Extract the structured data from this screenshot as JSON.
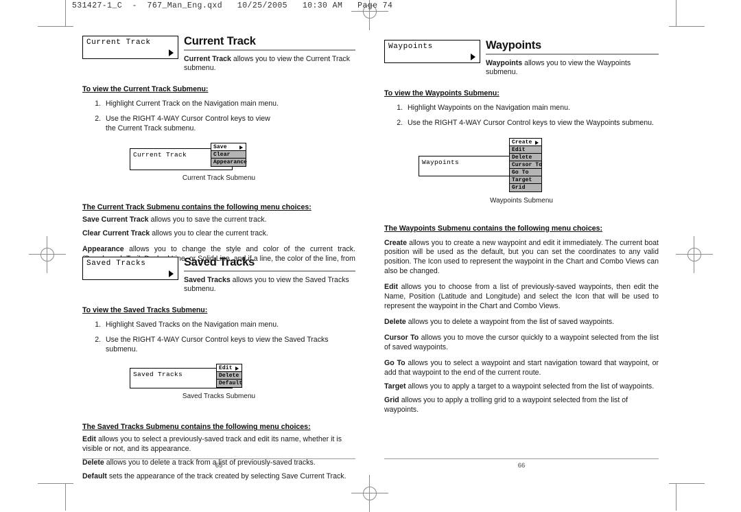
{
  "slug": "531427-1_C  -  767_Man_Eng.qxd   10/25/2005   10:30 AM   Page 74",
  "colors": {
    "menu_gray": "#b4b4b4",
    "rule_gray": "#9a9a9a",
    "text": "#1a1a1a",
    "mark_gray": "#8a8a8a"
  },
  "left_page": {
    "page_number": "65",
    "sections": [
      {
        "menu_box_label": "Current Track",
        "title": "Current Track",
        "intro_bold": "Current Track",
        "intro_rest": " allows you to view the Current Track submenu.",
        "steps_head": "To view the Current Track Submenu:",
        "steps": [
          "Highlight Current Track on the Navigation main menu.",
          "Use the RIGHT 4-WAY Cursor Control keys to view the Current Track submenu."
        ],
        "figure": {
          "box_label": "Current Track",
          "caption": "Current Track Submenu",
          "items": [
            {
              "label": "Save",
              "selected": true,
              "arrow": true
            },
            {
              "label": "Clear",
              "selected": false,
              "arrow": false
            },
            {
              "label": "Appearance",
              "selected": false,
              "arrow": false
            }
          ]
        },
        "choices_head": "The Current Track Submenu contains the following menu choices:",
        "choices": [
          {
            "term": "Save Current Track",
            "desc": " allows you to save the current track."
          },
          {
            "term": "Clear Current Track",
            "desc": " allows you to clear the current track."
          },
          {
            "term": "Appearance",
            "desc": " allows you to change the style and color of the current track. (Breadcrumb Trail, Dashed Line, or Solid Line, and if a line, the color of the line, from light to dark gray to black)."
          }
        ]
      },
      {
        "menu_box_label": "Saved Tracks",
        "title": "Saved Tracks",
        "intro_bold": "Saved Tracks",
        "intro_rest": " allows you to view the Saved Tracks submenu.",
        "steps_head": "To view the Saved Tracks Submenu:",
        "steps": [
          "Highlight Saved Tracks on the Navigation main menu.",
          "Use the RIGHT 4-WAY Cursor Control keys to view the Saved Tracks submenu."
        ],
        "figure": {
          "box_label": "Saved Tracks",
          "caption": "Saved Tracks Submenu",
          "items": [
            {
              "label": "Edit",
              "selected": true,
              "arrow": true
            },
            {
              "label": "Delete",
              "selected": false,
              "arrow": false
            },
            {
              "label": "Default",
              "selected": false,
              "arrow": false
            }
          ]
        },
        "choices_head": "The Saved Tracks Submenu contains the following menu choices:",
        "choices": [
          {
            "term": "Edit",
            "desc": " allows you to select a previously-saved track and edit its name, whether it is visible or not, and its appearance."
          },
          {
            "term": "Delete",
            "desc": " allows you to delete a track from a list of previously-saved tracks."
          },
          {
            "term": "Default",
            "desc": " sets the appearance of the track created by selecting Save Current Track."
          }
        ]
      }
    ]
  },
  "right_page": {
    "page_number": "66",
    "sections": [
      {
        "menu_box_label": "Waypoints",
        "title": "Waypoints",
        "intro_bold": "Waypoints",
        "intro_rest": " allows you to view the Waypoints submenu.",
        "steps_head": "To view the Waypoints Submenu:",
        "steps": [
          "Highlight Waypoints on the Navigation main menu.",
          "Use the RIGHT 4-WAY Cursor Control keys to view the Waypoints submenu."
        ],
        "figure": {
          "box_label": "Waypoints",
          "caption": "Waypoints Submenu",
          "items": [
            {
              "label": "Create",
              "selected": true,
              "arrow": true
            },
            {
              "label": "Edit",
              "selected": false,
              "arrow": false
            },
            {
              "label": "Delete",
              "selected": false,
              "arrow": false
            },
            {
              "label": "Cursor To",
              "selected": false,
              "arrow": false
            },
            {
              "label": "Go To",
              "selected": false,
              "arrow": false
            },
            {
              "label": "Target",
              "selected": false,
              "arrow": false
            },
            {
              "label": "Grid",
              "selected": false,
              "arrow": false
            }
          ]
        },
        "choices_head": "The Waypoints Submenu contains the following menu choices:",
        "choices": [
          {
            "term": "Create",
            "desc": " allows you to create a new waypoint and edit it immediately. The current boat position will be used as the default, but you can set the coordinates to any valid position. The Icon used to represent the waypoint in the Chart and Combo Views can also be changed."
          },
          {
            "term": "Edit",
            "desc": " allows you to choose from a list of previously-saved waypoints, then edit the Name, Position (Latitude and Longitude) and select the Icon that will be used to represent the waypoint in the Chart and Combo Views."
          },
          {
            "term": "Delete",
            "desc": " allows you to delete a waypoint from the list of saved waypoints."
          },
          {
            "term": "Cursor To",
            "desc": " allows you to move the cursor quickly to a waypoint selected from the list of saved waypoints."
          },
          {
            "term": "Go To",
            "desc": " allows you to select a waypoint and start navigation toward that waypoint, or add that waypoint to the end of the current route."
          },
          {
            "term": "Target",
            "desc": " allows you to apply a target to a waypoint selected from the list of waypoints."
          },
          {
            "term": "Grid",
            "desc": " allows you to apply a trolling grid to a waypoint selected from the list of waypoints."
          }
        ]
      }
    ]
  }
}
